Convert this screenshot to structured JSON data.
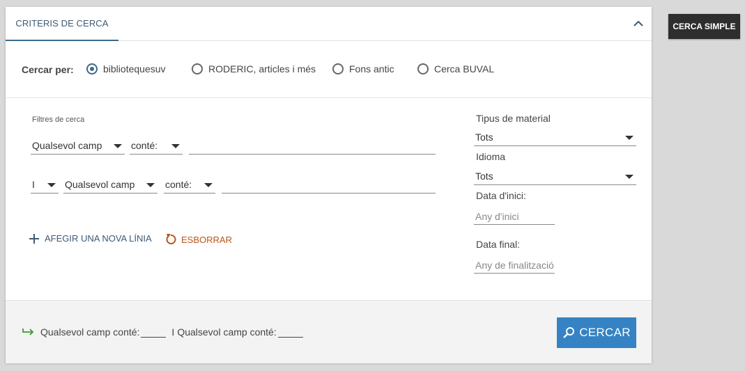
{
  "tab": {
    "label": "CRITERIS DE CERCA"
  },
  "scope": {
    "label": "Cercar per:",
    "options": [
      {
        "label": "bibliotequesuv",
        "checked": true
      },
      {
        "label": "RODERIC, articles i més",
        "checked": false
      },
      {
        "label": "Fons antic",
        "checked": false
      },
      {
        "label": "Cerca BUVAL",
        "checked": false
      }
    ]
  },
  "filters": {
    "label": "Filtres de cerca",
    "row1": {
      "field": "Qualsevol camp",
      "operator": "conté:",
      "value": ""
    },
    "row2": {
      "boolean": "I",
      "field": "Qualsevol camp",
      "operator": "conté:",
      "value": ""
    }
  },
  "actions": {
    "add_line": "AFEGIR UNA NOVA LÍNIA",
    "clear": "ESBORRAR"
  },
  "side": {
    "material_label": "Tipus de material",
    "material_value": "Tots",
    "language_label": "Idioma",
    "language_value": "Tots",
    "start_label": "Data d'inici:",
    "start_placeholder": "Any d'inici",
    "end_label": "Data final:",
    "end_placeholder": "Any de finalització"
  },
  "footer": {
    "summary": {
      "field1": "Qualsevol camp",
      "op1": "conté:",
      "bool": "I",
      "field2": "Qualsevol camp",
      "op2": "conté:"
    },
    "search_label": "CERCAR"
  },
  "simple_search_label": "CERCA SIMPLE",
  "colors": {
    "accent": "#3583c4",
    "tab_underline": "#3a6a8c",
    "clear": "#b8561a",
    "footer_arrow": "#3a9a3a"
  }
}
